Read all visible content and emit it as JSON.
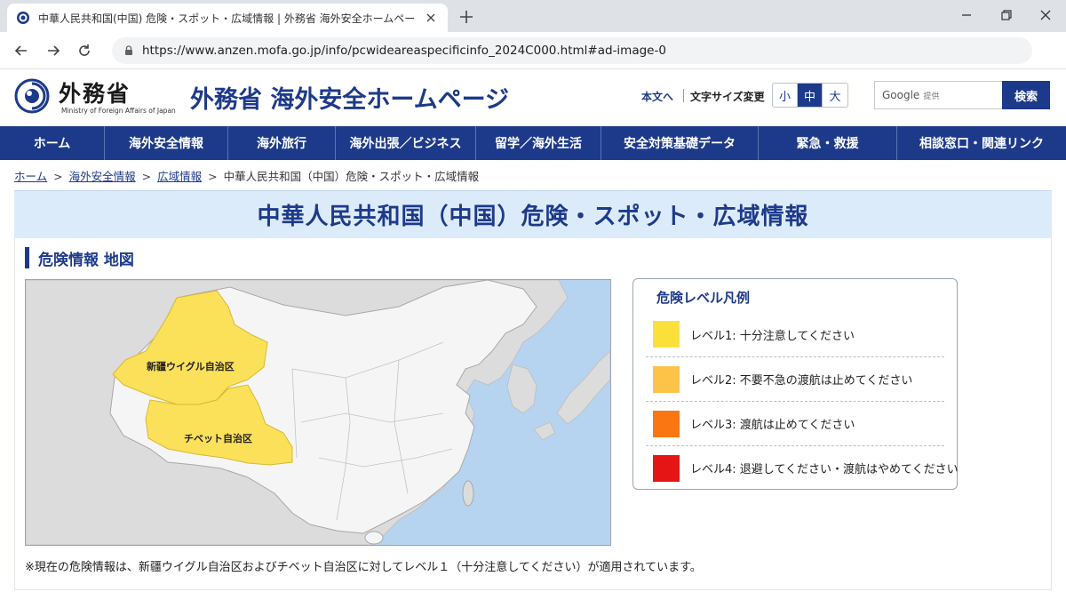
{
  "browser": {
    "tab_title": "中華人民共和国(中国) 危険・スポット・広域情報 | 外務省 海外安全ホームページ",
    "url": "https://www.anzen.mofa.go.jp/info/pcwideareaspecificinfo_2024C000.html#ad-image-0"
  },
  "header": {
    "ministry_name": "外務省",
    "ministry_name_en": "Ministry of Foreign Affairs of Japan",
    "site_title": "外務省 海外安全ホームページ",
    "skip_link": "本文へ",
    "font_size_label": "文字サイズ変更",
    "font_sizes": [
      "小",
      "中",
      "大"
    ],
    "font_size_selected": "中",
    "search_brand": "Google",
    "search_placeholder_sub": "提供",
    "search_button": "検索"
  },
  "nav": {
    "items": [
      "ホーム",
      "海外安全情報",
      "海外旅行",
      "海外出張／ビジネス",
      "留学／海外生活",
      "安全対策基礎データ",
      "緊急・救援",
      "相談窓口・関連リンク"
    ]
  },
  "breadcrumb": {
    "links": [
      "ホーム",
      "海外安全情報",
      "広域情報"
    ],
    "current": "中華人民共和国（中国）危険・スポット・広域情報"
  },
  "page": {
    "title": "中華人民共和国（中国）危険・スポット・広域情報",
    "section_heading": "危険情報 地図"
  },
  "map": {
    "regions": [
      {
        "name": "新疆ウイグル自治区",
        "level": 1
      },
      {
        "name": "チベット自治区",
        "level": 1
      }
    ],
    "colors": {
      "sea": "#b6d4f0",
      "land_other": "#dcdcdc",
      "china": "#f5f5f5",
      "border": "#b5b5b5",
      "level1": "#fbe05a"
    }
  },
  "legend": {
    "title": "危険レベル凡例",
    "levels": [
      {
        "label": "レベル1: 十分注意してください",
        "color": "#fbe03c"
      },
      {
        "label": "レベル2: 不要不急の渡航は止めてください",
        "color": "#fbc347"
      },
      {
        "label": "レベル3: 渡航は止めてください",
        "color": "#f97612"
      },
      {
        "label": "レベル4: 退避してください・渡航はやめてください",
        "color": "#e61515"
      }
    ]
  },
  "note": "※現在の危険情報は、新疆ウイグル自治区およびチベット自治区に対してレベル１（十分注意してください）が適用されています。"
}
